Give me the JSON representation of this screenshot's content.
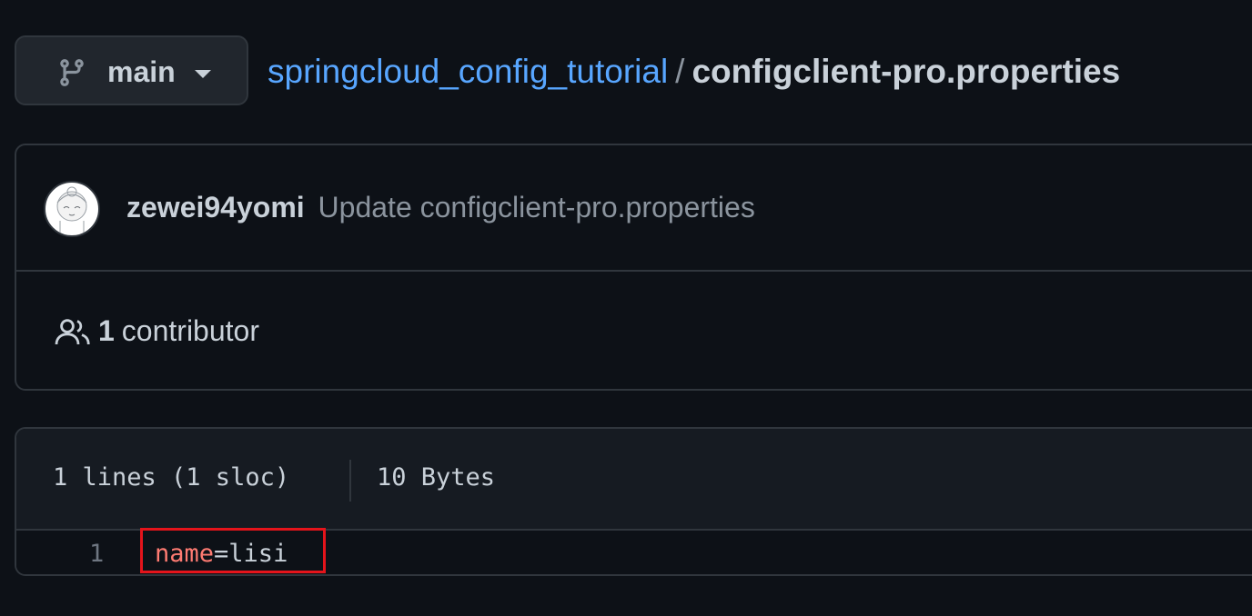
{
  "branch": {
    "label": "main",
    "icon": "git-branch-icon"
  },
  "breadcrumb": {
    "repo": "springcloud_config_tutorial",
    "separator": "/",
    "file": "configclient-pro.properties"
  },
  "commit": {
    "author": "zewei94yomi",
    "message": "Update configclient-pro.properties"
  },
  "contributors": {
    "count": "1",
    "label": "contributor",
    "icon": "people-icon"
  },
  "file": {
    "lines_info": "1 lines (1 sloc)",
    "size": "10 Bytes",
    "code": [
      {
        "number": "1",
        "key": "name",
        "op": "=",
        "value": "lisi"
      }
    ]
  },
  "colors": {
    "background": "#0d1117",
    "link": "#58a6ff",
    "border": "#30363d",
    "highlight_box": "#e4141b",
    "syntax_key": "#ff7b72"
  }
}
